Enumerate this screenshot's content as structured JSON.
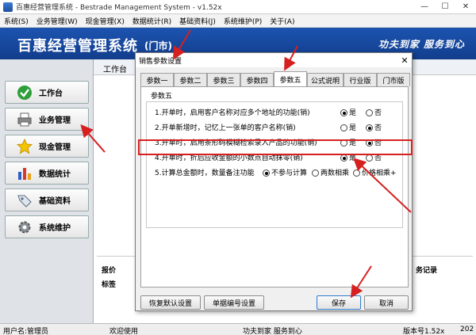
{
  "window": {
    "title": "百惠经营管理系统 - Bestrade Management System - v1.52x",
    "minimize": "—",
    "maximize": "☐",
    "close": "✕"
  },
  "menu": [
    "系统(S)",
    "业务管理(W)",
    "现金管理(X)",
    "数据统计(R)",
    "基础资料(J)",
    "系统维护(P)",
    "关于(A)"
  ],
  "banner": {
    "name": "百惠经营管理系统",
    "subtitle": "(门市)",
    "slogan": "功夫到家 服务到心"
  },
  "sidebar": {
    "items": [
      {
        "label": "工作台",
        "icon": "check-icon"
      },
      {
        "label": "业务管理",
        "icon": "printer-icon"
      },
      {
        "label": "现金管理",
        "icon": "star-icon"
      },
      {
        "label": "数据统计",
        "icon": "bar-chart-icon"
      },
      {
        "label": "基础资料",
        "icon": "tag-icon"
      },
      {
        "label": "系统维护",
        "icon": "gear-icon"
      }
    ]
  },
  "main": {
    "tab_label": "工作台",
    "panel_item1": "报价",
    "panel_item2": "标签",
    "panel_item3": "务记录"
  },
  "dialog": {
    "title": "销售参数设置",
    "close": "✕",
    "tabs": [
      "参数一",
      "参数二",
      "参数三",
      "参数四",
      "参数五",
      "公式说明",
      "行业版",
      "门市版"
    ],
    "active_tab": 4,
    "group_title": "参数五",
    "rows": [
      {
        "text": "1.开单时，启用客户名称对应多个地址的功能(销)",
        "yes": "是",
        "no": "否",
        "selected": "yes"
      },
      {
        "text": "2.开单新增时，记忆上一张单的客户名称(销)",
        "yes": "是",
        "no": "否",
        "selected": "no"
      },
      {
        "text": "3.开单时，启用条形码模糊检索录入产品的功能(销)",
        "yes": "是",
        "no": "否",
        "selected": "no"
      },
      {
        "text": "4.开单时，折后应收金额的小数点自动抹零(销)",
        "yes": "是",
        "no": "否",
        "selected": "yes"
      }
    ],
    "row5": {
      "text": "5.计算总金额时，数量备注功能",
      "options": [
        "不参与计算",
        "两数相乘",
        "价格相乘+"
      ],
      "selected": 0
    },
    "buttons": {
      "reset": "恢复默认设置",
      "numbering": "单据编号设置",
      "save": "保存",
      "cancel": "取消"
    }
  },
  "status": {
    "user": "用户名:管理员",
    "welcome": "欢迎使用",
    "slogan": "功夫到家 服务到心",
    "version": "版本号1.52x",
    "date": "202"
  },
  "colors": {
    "banner": "#1c54b0",
    "highlight": "#d62020",
    "arrow": "#d62020"
  }
}
